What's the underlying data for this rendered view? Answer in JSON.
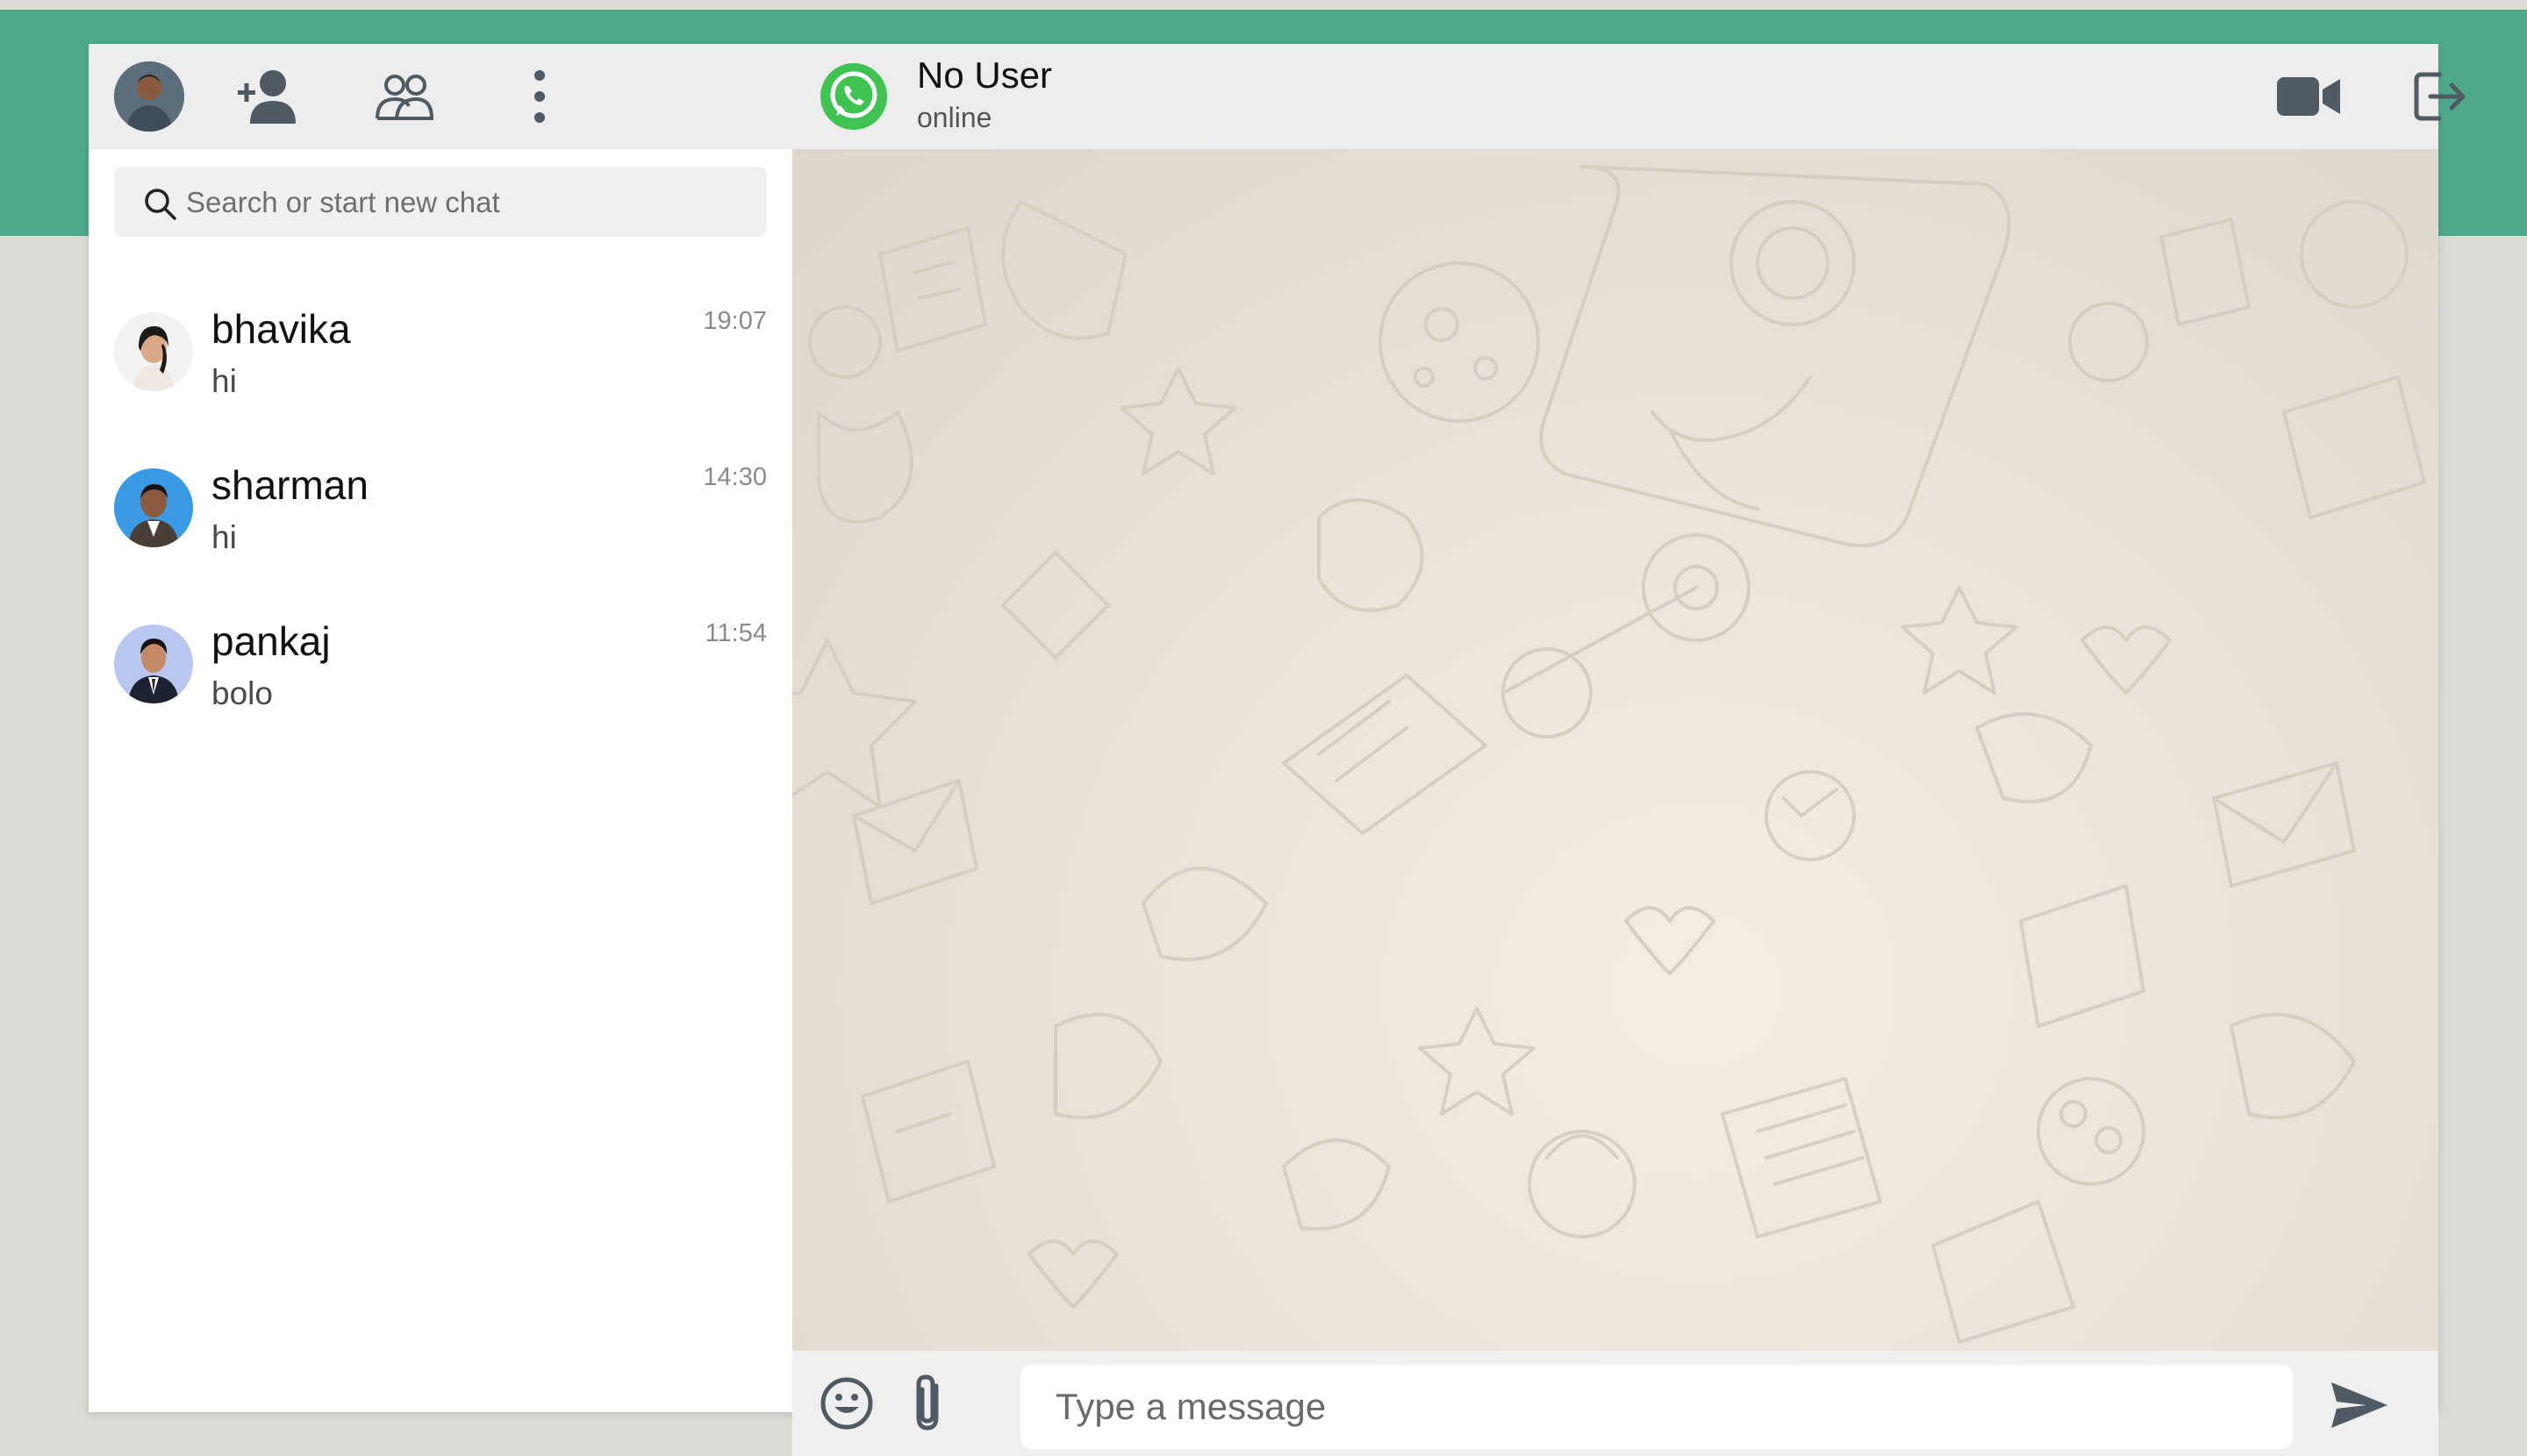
{
  "colors": {
    "brand_green": "#4ea98a",
    "icon_gray": "#505a62",
    "whatsapp_green": "#3fc451"
  },
  "sidebar": {
    "header": {
      "icons": [
        "add-contact-icon",
        "group-icon",
        "more-menu-icon"
      ]
    },
    "search": {
      "placeholder": "Search or start new chat"
    },
    "chats": [
      {
        "name": "bhavika",
        "last_message": "hi",
        "time": "19:07"
      },
      {
        "name": "sharman",
        "last_message": "hi",
        "time": "14:30"
      },
      {
        "name": "pankaj",
        "last_message": "bolo",
        "time": "11:54"
      }
    ]
  },
  "chat": {
    "contact_name": "No User",
    "status": "online",
    "header_icons": [
      "video-call-icon",
      "logout-icon"
    ],
    "composer": {
      "placeholder": "Type a message"
    }
  }
}
